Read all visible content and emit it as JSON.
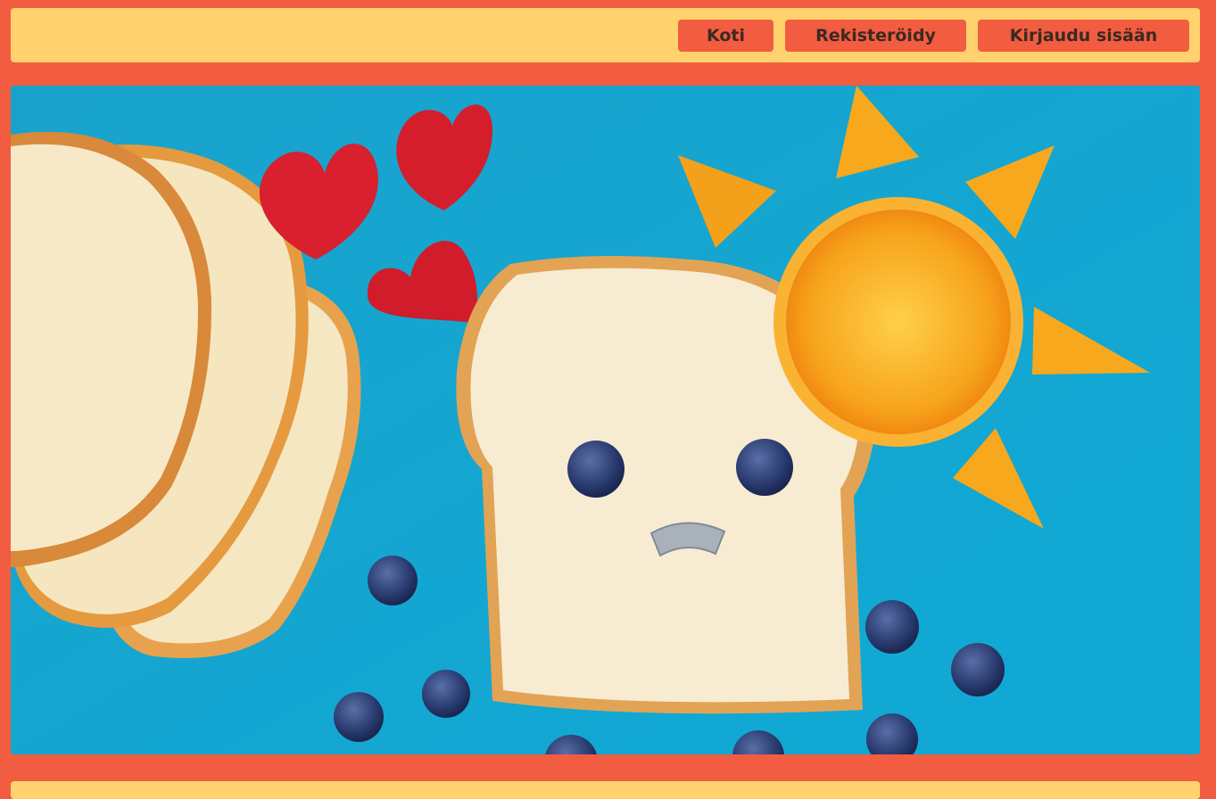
{
  "nav": {
    "home_label": "Koti",
    "register_label": "Rekisteröidy",
    "login_label": "Kirjaudu sisään"
  },
  "colors": {
    "page_background": "#f25c40",
    "nav_background": "#ffd26e",
    "button_background": "#f25c40",
    "button_text": "#3a2a22",
    "hero_background": "#17a6cf"
  },
  "hero": {
    "image_subject": "bread-smiley-face-with-fruit-photo"
  }
}
